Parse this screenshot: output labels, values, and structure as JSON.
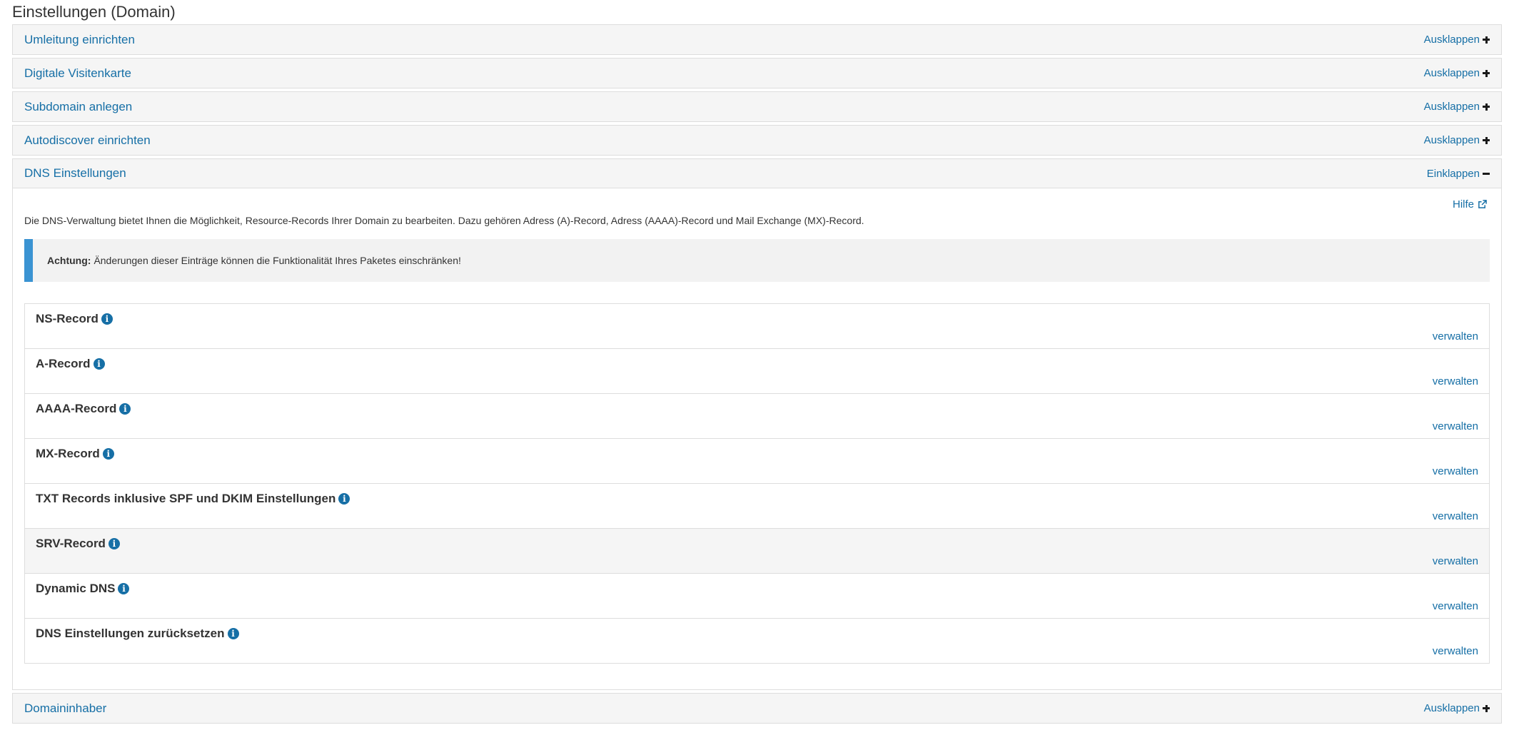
{
  "page_title": "Einstellungen (Domain)",
  "collapsed_panels_top": [
    {
      "title": "Umleitung einrichten",
      "toggle": "Ausklappen"
    },
    {
      "title": "Digitale Visitenkarte",
      "toggle": "Ausklappen"
    },
    {
      "title": "Subdomain anlegen",
      "toggle": "Ausklappen"
    },
    {
      "title": "Autodiscover einrichten",
      "toggle": "Ausklappen"
    }
  ],
  "dns_panel": {
    "title": "DNS Einstellungen",
    "toggle": "Einklappen",
    "help_label": "Hilfe",
    "description": "Die DNS-Verwaltung bietet Ihnen die Möglichkeit, Resource-Records Ihrer Domain zu bearbeiten. Dazu gehören Adress (A)-Record, Adress (AAAA)-Record und Mail Exchange (MX)-Record.",
    "alert_label": "Achtung:",
    "alert_text": "Änderungen dieser Einträge können die Funktionalität Ihres Paketes einschränken!",
    "records": [
      {
        "title": "NS-Record",
        "action": "verwalten"
      },
      {
        "title": "A-Record",
        "action": "verwalten"
      },
      {
        "title": "AAAA-Record",
        "action": "verwalten"
      },
      {
        "title": "MX-Record",
        "action": "verwalten"
      },
      {
        "title": "TXT Records inklusive SPF und DKIM Einstellungen",
        "action": "verwalten"
      },
      {
        "title": "SRV-Record",
        "action": "verwalten"
      },
      {
        "title": "Dynamic DNS",
        "action": "verwalten"
      },
      {
        "title": "DNS Einstellungen zurücksetzen",
        "action": "verwalten"
      }
    ]
  },
  "collapsed_panels_bottom": [
    {
      "title": "Domaininhaber",
      "toggle": "Ausklappen"
    }
  ],
  "colors": {
    "link": "#166fa6",
    "alert_border": "#3a93d2",
    "panel_bg": "#f5f5f5",
    "border": "#dddddd"
  }
}
